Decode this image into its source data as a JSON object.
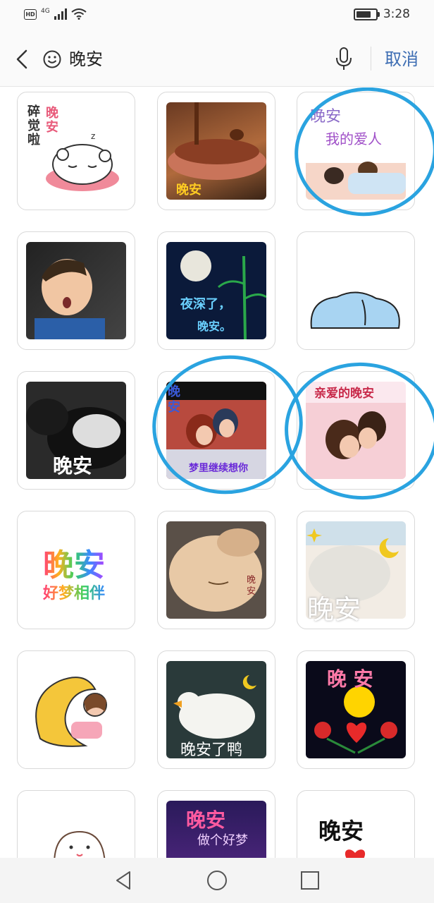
{
  "status_bar": {
    "network": "4G",
    "hd_label": "HD",
    "time": "3:28",
    "battery_level": 0.85
  },
  "search": {
    "query": "晚安",
    "cancel_label": "取消"
  },
  "stickers": [
    {
      "caption": "碎觉啦",
      "caption2": "晚安"
    },
    {
      "caption": "晚安"
    },
    {
      "caption": "晚安",
      "caption2": "我的爱人"
    },
    {
      "caption": ""
    },
    {
      "caption": "夜深了，",
      "caption2": "晚安。"
    },
    {
      "caption": ""
    },
    {
      "caption": "晚安"
    },
    {
      "caption": "晚安",
      "caption2": "梦里继续想你"
    },
    {
      "caption": "亲爱的晚安"
    },
    {
      "caption": "晚安",
      "caption2": "好梦相伴"
    },
    {
      "caption": "晚安"
    },
    {
      "caption": "晚安"
    },
    {
      "caption": ""
    },
    {
      "caption": "晚安了鸭"
    },
    {
      "caption": "晚 安"
    },
    {
      "caption": ""
    },
    {
      "caption": "晚安",
      "caption2": "做个好梦"
    },
    {
      "caption": "晚安"
    }
  ],
  "colors": {
    "accent_blue": "#3d6db3",
    "annotation_blue": "#2aa3e0"
  }
}
